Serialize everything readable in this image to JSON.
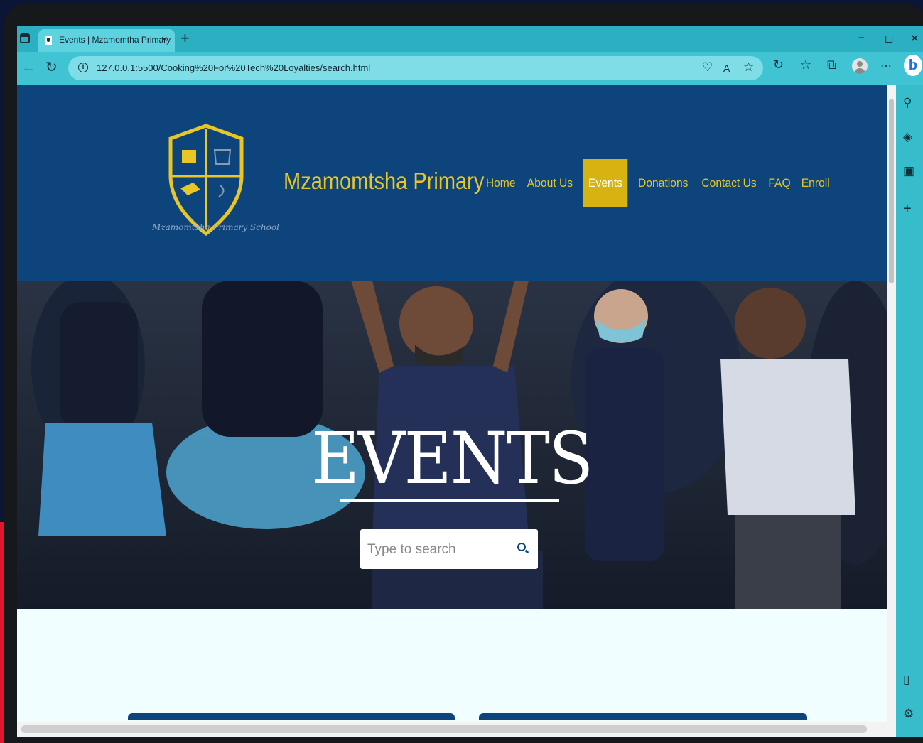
{
  "browser": {
    "tab_title": "Events | Mzamomtha Primary",
    "tab_close": "×",
    "new_tab": "+",
    "url": "127.0.0.1:5500/Cooking%20For%20Tech%20Loyalties/search.html",
    "window_minimize": "−",
    "window_restore": "◻",
    "window_close": "✕",
    "bing_label": "b"
  },
  "header": {
    "logo_caption": "Mzamomtsha Primary School",
    "brand": "Mzamomtsha Primary",
    "nav": [
      "Home",
      "About Us",
      "Events",
      "Donations",
      "Contact Us",
      "FAQ",
      "Enroll"
    ],
    "active_nav": "Events"
  },
  "hero": {
    "title": "EVENTS",
    "search_placeholder": "Type to search"
  },
  "colors": {
    "header_bg": "#0e447c",
    "brand_yellow": "#e7c625",
    "active_nav_bg": "#d7b312",
    "browser_chrome": "#35b9c9"
  }
}
